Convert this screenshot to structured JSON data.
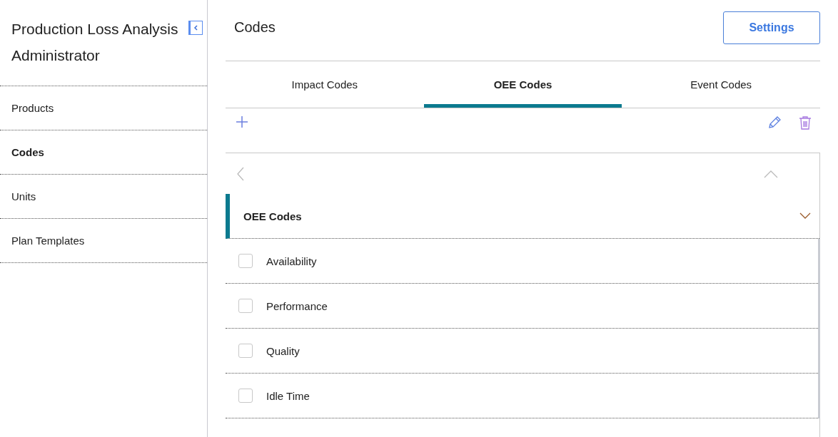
{
  "sidebar": {
    "title": "Production Loss Analysis Administrator",
    "items": [
      {
        "label": "Products",
        "selected": false
      },
      {
        "label": "Codes",
        "selected": true
      },
      {
        "label": "Units",
        "selected": false
      },
      {
        "label": "Plan Templates",
        "selected": false
      }
    ]
  },
  "header": {
    "title": "Codes",
    "settings_button": "Settings"
  },
  "tabs": [
    {
      "label": "Impact Codes",
      "selected": false
    },
    {
      "label": "OEE Codes",
      "selected": true
    },
    {
      "label": "Event Codes",
      "selected": false
    }
  ],
  "list": {
    "section_title": "OEE Codes",
    "expanded": true,
    "rows": [
      {
        "label": "Availability",
        "checked": false
      },
      {
        "label": "Performance",
        "checked": false
      },
      {
        "label": "Quality",
        "checked": false
      },
      {
        "label": "Idle Time",
        "checked": false
      }
    ]
  }
}
